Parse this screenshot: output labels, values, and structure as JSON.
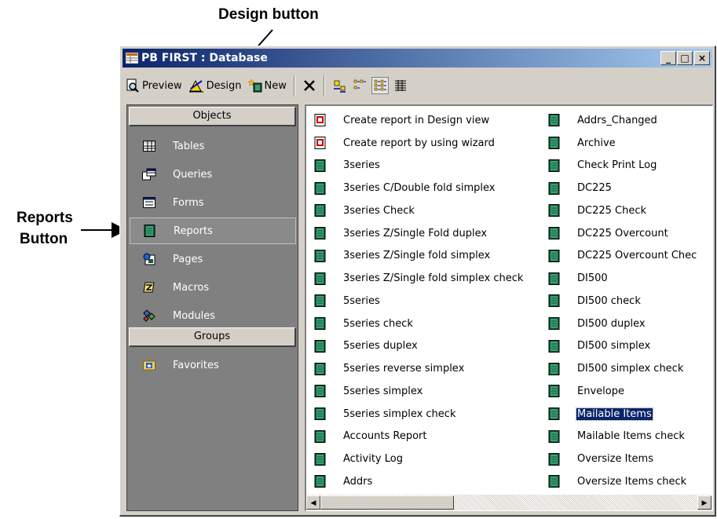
{
  "callouts": {
    "design": "Design button",
    "reports_line1": "Reports",
    "reports_line2": "Button"
  },
  "window": {
    "title": "PB FIRST : Database",
    "buttons": {
      "minimize": "_",
      "maximize": "□",
      "close": "×"
    }
  },
  "toolbar": {
    "preview_label": "Preview",
    "design_label": "Design",
    "new_label": "New"
  },
  "objects_pane": {
    "header": "Objects",
    "items": [
      "Tables",
      "Queries",
      "Forms",
      "Reports",
      "Pages",
      "Macros",
      "Modules"
    ],
    "selected": "Reports",
    "groups_header": "Groups",
    "groups_items": [
      "Favorites"
    ]
  },
  "reports_list": {
    "column1": [
      "Create report in Design view",
      "Create report by using wizard",
      "3series",
      "3series C/Double fold simplex",
      "3series Check",
      "3series Z/Single Fold duplex",
      "3series Z/Single fold simplex",
      "3series Z/Single fold simplex check",
      "5series",
      "5series check",
      "5series duplex",
      "5series reverse simplex",
      "5series simplex",
      "5series simplex check",
      "Accounts Report",
      "Activity Log",
      "Addrs"
    ],
    "column2": [
      "Addrs_Changed",
      "Archive",
      "Check Print Log",
      "DC225",
      "DC225 Check",
      "DC225 Overcount",
      "DC225 Overcount Chec",
      "DI500",
      "DI500 check",
      "DI500 duplex",
      "DI500 simplex",
      "DI500 simplex check",
      "Envelope",
      "Mailable Items",
      "Mailable Items check",
      "Oversize Items",
      "Oversize Items check"
    ],
    "selected": "Mailable Items"
  },
  "colors": {
    "titlebar_start": "#0a246a",
    "titlebar_end": "#a6caf0",
    "pane_bg": "#808080",
    "selection": "#0a246a",
    "report_icon": "#0f5a3a"
  }
}
